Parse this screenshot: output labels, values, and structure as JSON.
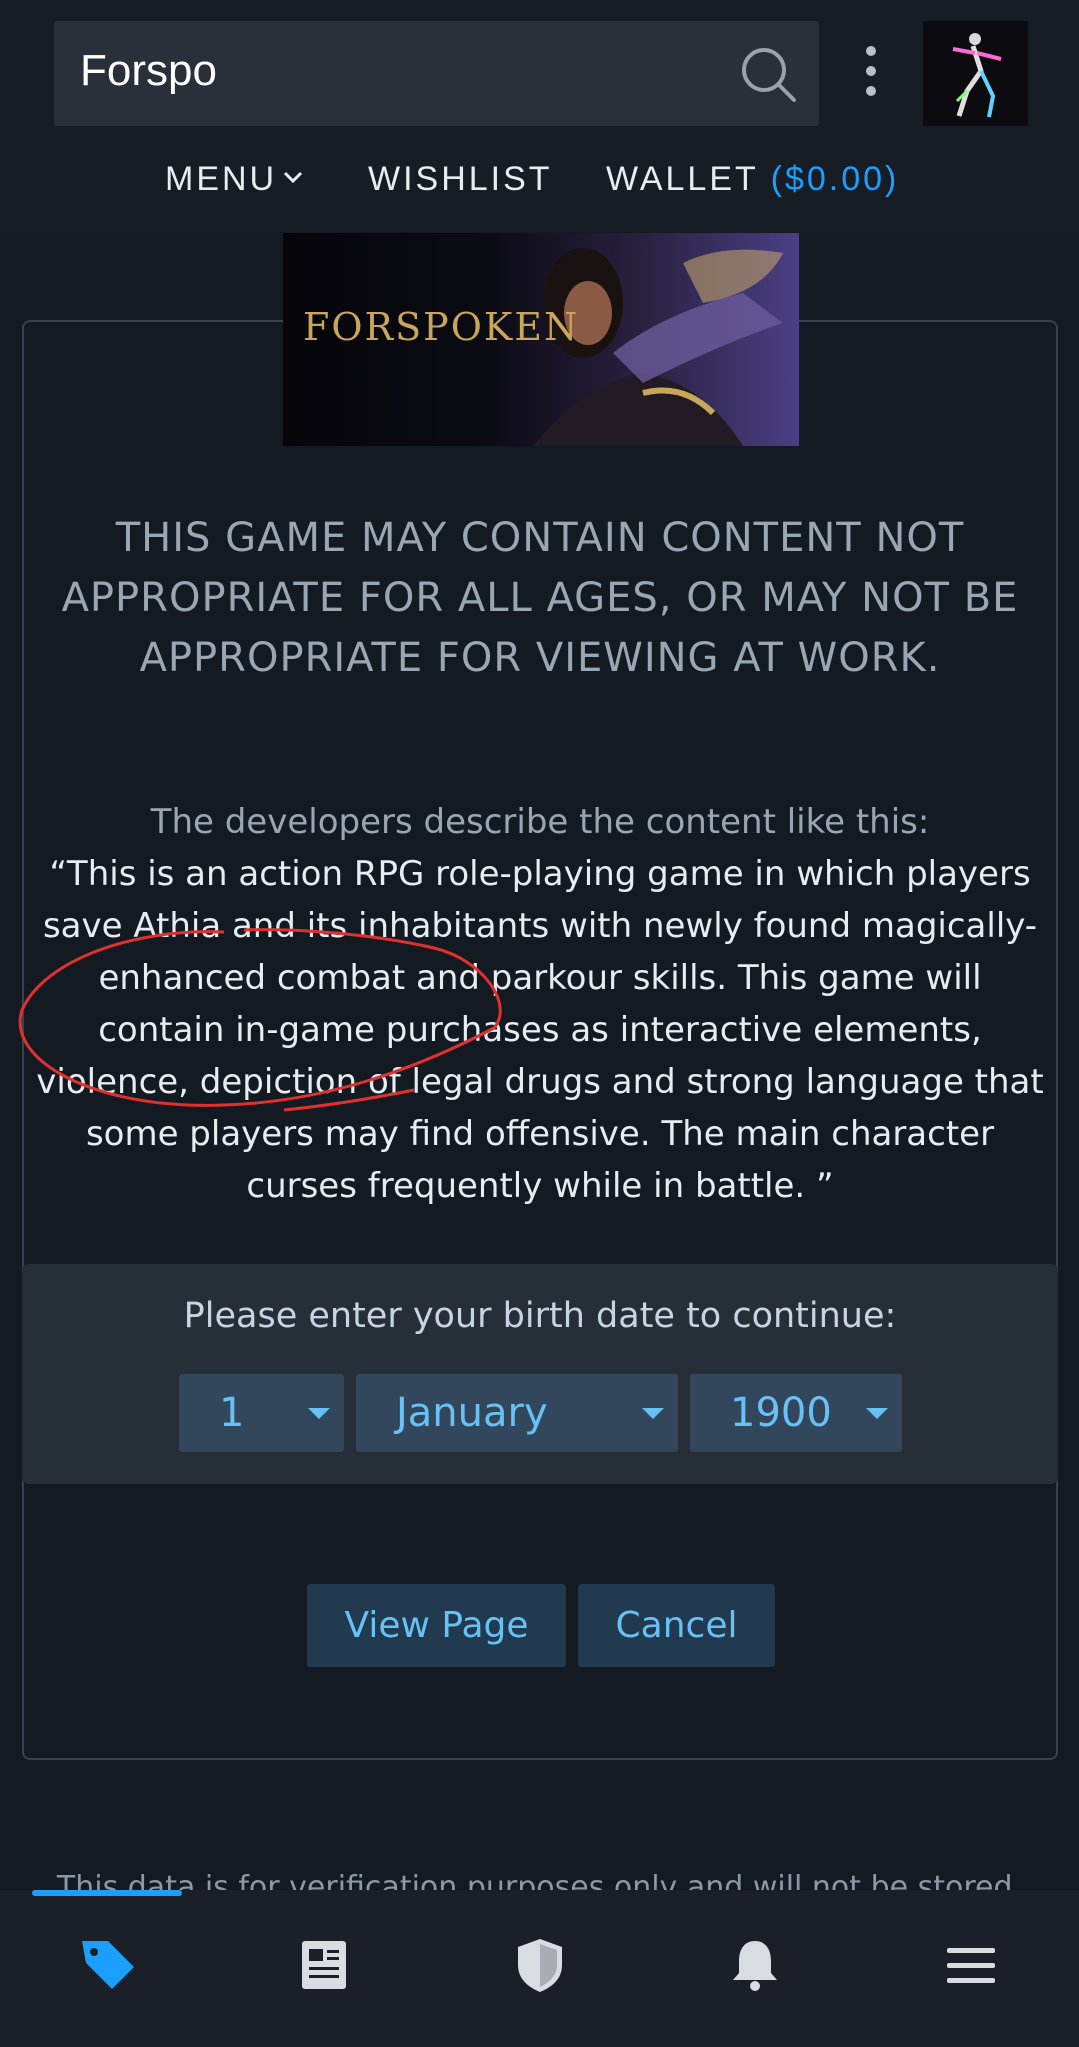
{
  "header": {
    "search_value": "Forspo",
    "nav": {
      "menu": "MENU",
      "wishlist": "WISHLIST",
      "wallet": "WALLET",
      "wallet_amount": "($0.00)"
    }
  },
  "banner": {
    "title": "FORSPOKEN"
  },
  "content": {
    "warning": "THIS GAME MAY CONTAIN CONTENT NOT APPROPRIATE FOR ALL AGES, OR MAY NOT BE APPROPRIATE FOR VIEWING AT WORK.",
    "developers_intro": "The developers describe the content like this:",
    "developers_quote": "“This is an action RPG role-playing game in which players save Athia and its inhabitants with newly found magically-enhanced combat and parkour skills. This game will contain in-game purchases as interactive elements, violence, depiction of legal drugs and strong language that some players may find offensive. The main character curses frequently while in battle. ”"
  },
  "birth": {
    "label": "Please enter your birth date to continue:",
    "day": "1",
    "month": "January",
    "year": "1900"
  },
  "buttons": {
    "view_page": "View Page",
    "cancel": "Cancel"
  },
  "footnote": "This data is for verification purposes only and will not be stored.",
  "colors": {
    "accent": "#1a9fff",
    "link": "#67c1f5",
    "annotation": "#e0312f"
  },
  "bottom_nav": {
    "active": "store",
    "icons": [
      "tag-icon",
      "news-icon",
      "shield-icon",
      "bell-icon",
      "hamburger-icon"
    ]
  }
}
